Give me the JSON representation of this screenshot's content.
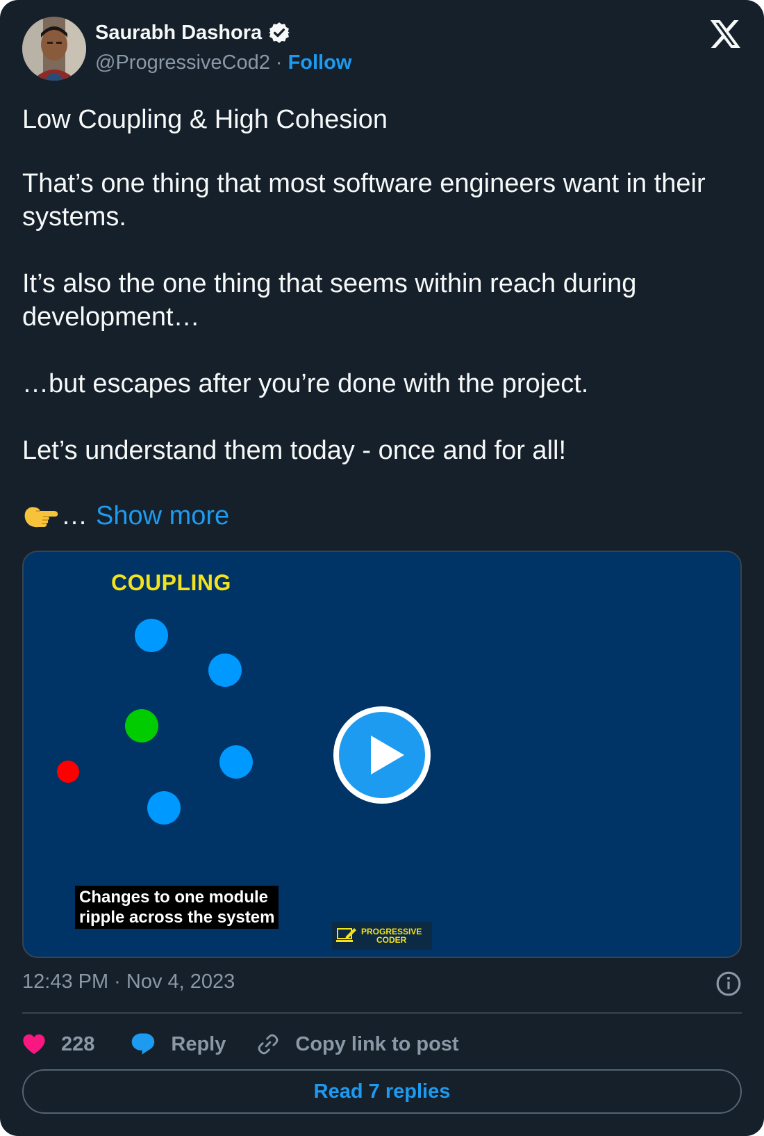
{
  "author": {
    "name": "Saurabh Dashora",
    "handle": "@ProgressiveCod2",
    "separator": "·",
    "follow_label": "Follow"
  },
  "tweet": {
    "paragraphs": [
      "Low Coupling & High Cohesion",
      "That’s one thing that most software engineers want in their systems.",
      "It’s also the one thing that seems within reach during development…",
      "…but escapes after you’re done with the project.",
      "Let’s understand them today - once and for all!"
    ],
    "ellipsis": "…",
    "show_more_label": "Show more"
  },
  "media": {
    "title": "COUPLING",
    "caption_line1": "Changes to one module",
    "caption_line2": "ripple across the system",
    "brand_line1": "PROGRESSIVE",
    "brand_line2": "CODER",
    "colors": {
      "background": "#003366",
      "module": "#0099ff",
      "highlight": "#00cc00",
      "alert": "#ff0000",
      "title": "#f3e21c"
    }
  },
  "footer": {
    "timestamp": "12:43 PM · Nov 4, 2023",
    "likes": "228",
    "reply_label": "Reply",
    "copy_link_label": "Copy link to post",
    "read_replies_label": "Read 7 replies"
  },
  "icons": [
    "verified-badge-icon",
    "x-logo-icon",
    "pointing-hand-icon",
    "play-icon",
    "info-icon",
    "heart-icon",
    "reply-bubble-icon",
    "link-icon"
  ],
  "colors": {
    "accent": "#1d9bf0",
    "background": "#15202b",
    "like": "#f91880"
  }
}
